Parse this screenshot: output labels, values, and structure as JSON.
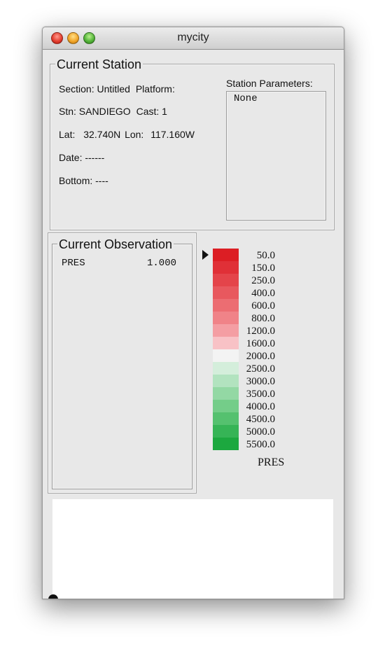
{
  "window": {
    "title": "mycity"
  },
  "current_station": {
    "legend": "Current Station",
    "section_label": "Section:",
    "section_value": "Untitled",
    "platform_label": "Platform:",
    "platform_value": "",
    "stn_label": "Stn:",
    "stn_value": "SANDIEGO",
    "cast_label": "Cast:",
    "cast_value": "1",
    "lat_label": "Lat:",
    "lat_value": "32.740N",
    "lon_label": "Lon:",
    "lon_value": "117.160W",
    "date_label": "Date:",
    "date_value": "------",
    "bottom_label": "Bottom:",
    "bottom_value": "----",
    "station_parameters_label": "Station Parameters:",
    "station_parameters_value": "None"
  },
  "current_observation": {
    "legend": "Current Observation",
    "rows": [
      {
        "name": "PRES",
        "value": "1.000"
      }
    ]
  },
  "color_scale": {
    "variable": "PRES",
    "selected_index": 0,
    "ticks": [
      "50.0",
      "150.0",
      "250.0",
      "400.0",
      "600.0",
      "800.0",
      "1200.0",
      "1600.0",
      "2000.0",
      "2500.0",
      "3000.0",
      "3500.0",
      "4000.0",
      "4500.0",
      "5000.0",
      "5500.0"
    ],
    "colors": [
      "#dc1e24",
      "#e03037",
      "#e4444a",
      "#e8585e",
      "#ec6d72",
      "#f08388",
      "#f49ea3",
      "#f8c2c6",
      "#f3f3f3",
      "#d4eedb",
      "#b2e3bf",
      "#93d8a4",
      "#74cd89",
      "#55c16f",
      "#36b456",
      "#1ca83f"
    ]
  }
}
